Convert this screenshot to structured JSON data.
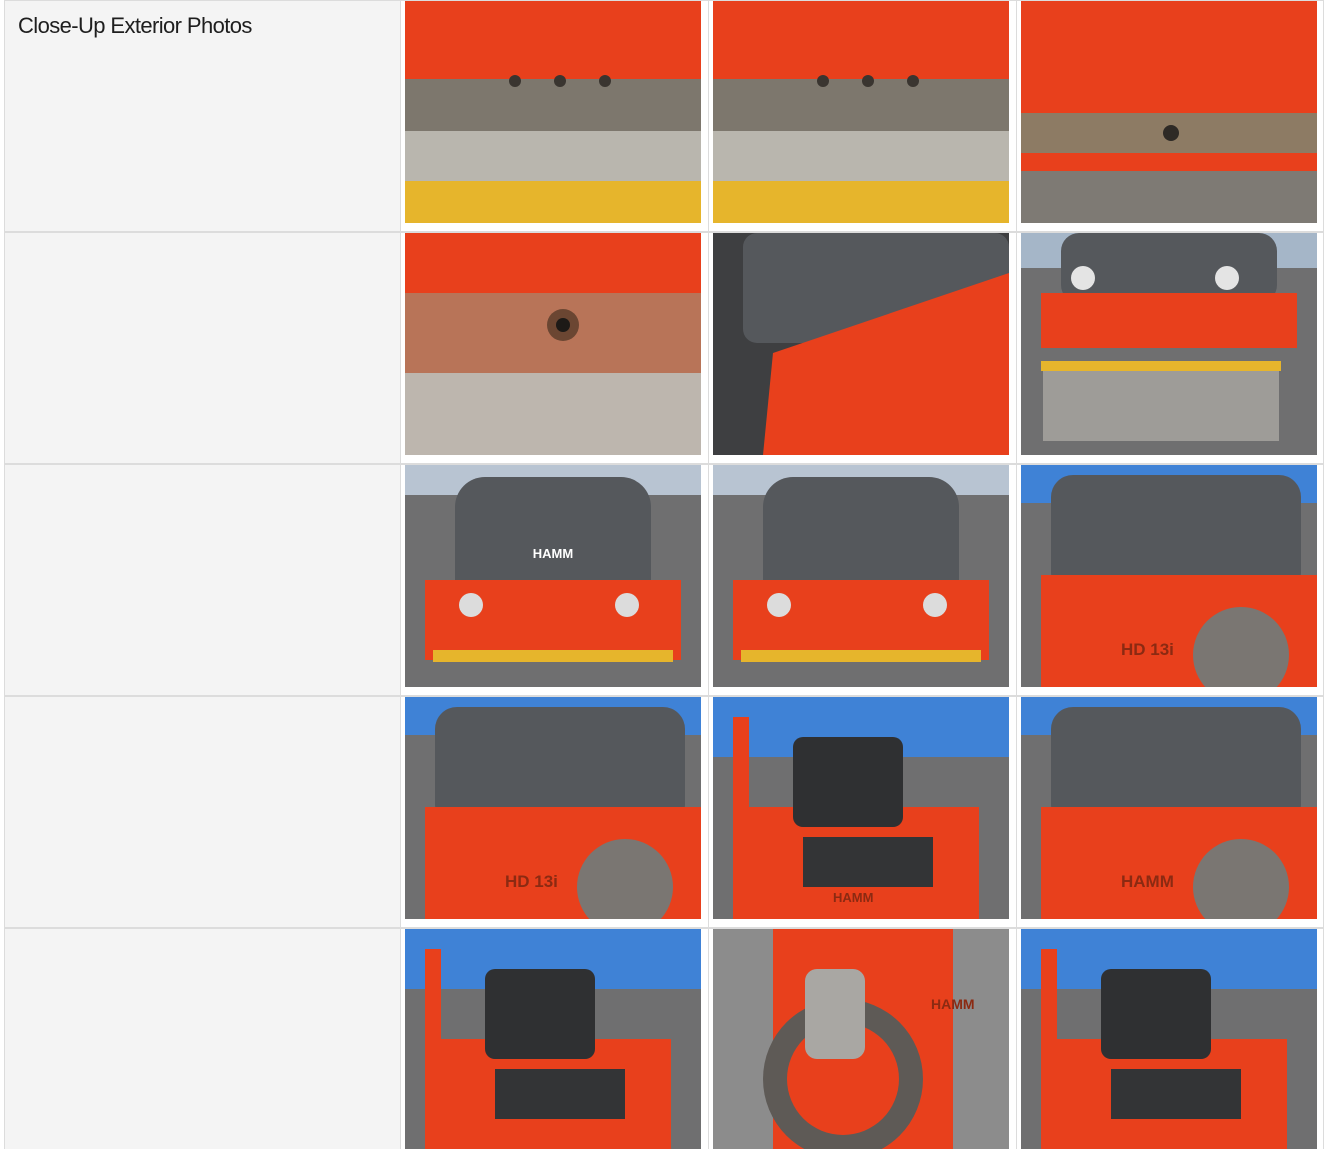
{
  "section": {
    "title": "Close-Up Exterior Photos"
  },
  "photos": [
    {
      "name": "photo-1",
      "alt": "Close-up of orange frame edge above drum scraper bar"
    },
    {
      "name": "photo-2",
      "alt": "Close-up of orange frame edge with bolts and scraper bar"
    },
    {
      "name": "photo-3",
      "alt": "Close-up of orange frame lower edge with hole"
    },
    {
      "name": "photo-4",
      "alt": "Close-up of rusted fitting under orange frame"
    },
    {
      "name": "photo-5",
      "alt": "Close-up of hood corner and orange body panel"
    },
    {
      "name": "photo-6",
      "alt": "Rear of roller with lights and drum"
    },
    {
      "name": "photo-7",
      "alt": "Front view of HAMM roller hood",
      "decal_text": "HAMM"
    },
    {
      "name": "photo-8",
      "alt": "Angled view of roller hood and front drum"
    },
    {
      "name": "photo-9",
      "alt": "Side view of hood and HD 13i body",
      "decal_text": "HD 13i"
    },
    {
      "name": "photo-10",
      "alt": "Side view of HD 13i with drum",
      "decal_text": "HD 13i"
    },
    {
      "name": "photo-11",
      "alt": "Operator seat and platform view",
      "decal_text": "HAMM"
    },
    {
      "name": "photo-12",
      "alt": "Rear drum and body with HAMM lettering",
      "decal_text": "HAMM"
    },
    {
      "name": "photo-13",
      "alt": "Operator seat and rollover frame view"
    },
    {
      "name": "photo-14",
      "alt": "Front drum and articulation view",
      "decal_text": "HAMM"
    },
    {
      "name": "photo-15",
      "alt": "Rear quarter view of roller with seat"
    }
  ],
  "colors": {
    "machine_orange": "#e8401c",
    "hood_gray": "#55585c",
    "gravel": "#6f6f70",
    "sky": "#3f82d6",
    "drum_yellow": "#e6b52c",
    "label_bg": "#f4f4f4",
    "border": "#dcdcdc"
  }
}
